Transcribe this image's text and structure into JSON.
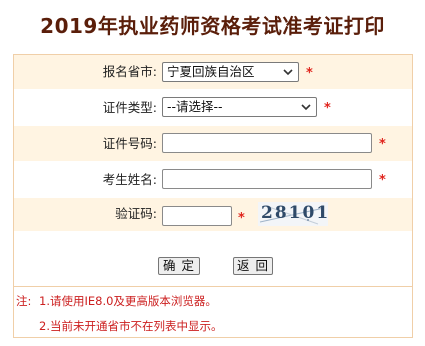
{
  "title": "2019年执业药师资格考试准考证打印",
  "fields": {
    "province": {
      "label": "报名省市:",
      "value": "宁夏回族自治区",
      "required": "*"
    },
    "id_type": {
      "label": "证件类型:",
      "value": "--请选择--",
      "required": "*"
    },
    "id_number": {
      "label": "证件号码:",
      "value": "",
      "required": "*"
    },
    "name": {
      "label": "考生姓名:",
      "value": "",
      "required": "*"
    },
    "captcha": {
      "label": "验证码:",
      "value": "",
      "required": "*",
      "image_text": "28101"
    }
  },
  "buttons": {
    "confirm": "确 定",
    "back": "返 回"
  },
  "notes": {
    "prefix": "注:",
    "line1": "1.请使用IE8.0及更高版本浏览器。",
    "line2": "2.当前未开通省市不在列表中显示。"
  },
  "colors": {
    "title": "#5a1e0a",
    "row_tint": "#fff4e2",
    "border": "#f0cfa8",
    "required": "#e0241c",
    "note": "#cc2020"
  }
}
